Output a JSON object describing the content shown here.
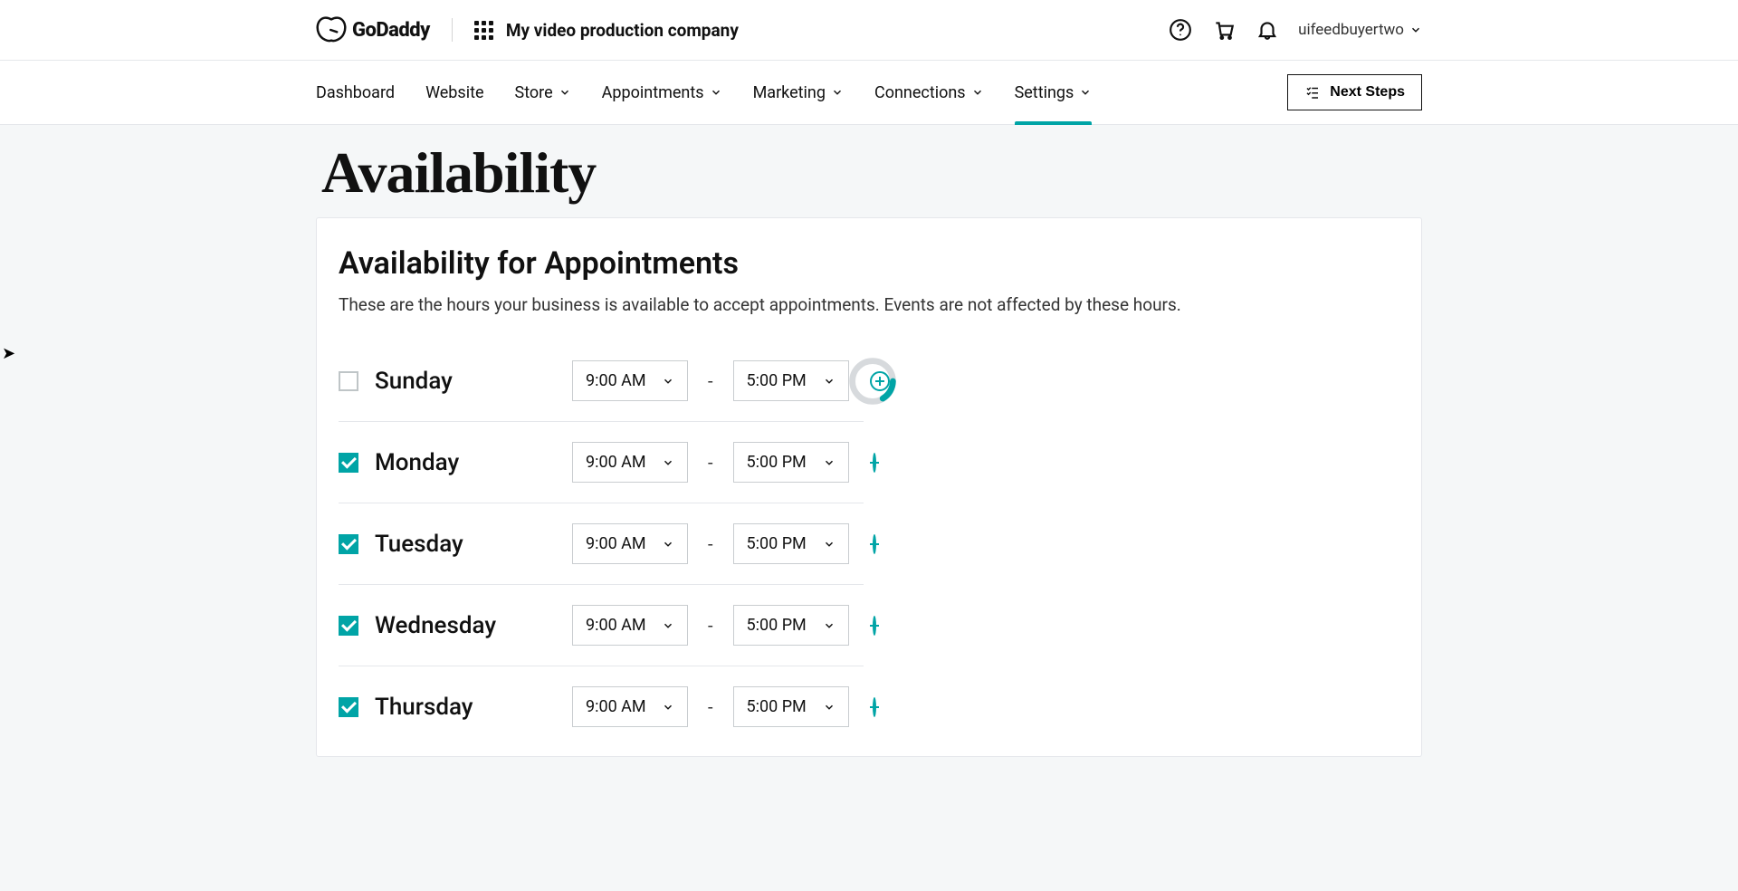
{
  "header": {
    "brand": "GoDaddy",
    "company": "My video production company",
    "user": "uifeedbuyertwo"
  },
  "nav": {
    "items": [
      {
        "label": "Dashboard",
        "dropdown": false,
        "active": false
      },
      {
        "label": "Website",
        "dropdown": false,
        "active": false
      },
      {
        "label": "Store",
        "dropdown": true,
        "active": false
      },
      {
        "label": "Appointments",
        "dropdown": true,
        "active": false
      },
      {
        "label": "Marketing",
        "dropdown": true,
        "active": false
      },
      {
        "label": "Connections",
        "dropdown": true,
        "active": false
      },
      {
        "label": "Settings",
        "dropdown": true,
        "active": true
      }
    ],
    "next_steps": "Next Steps"
  },
  "page": {
    "title": "Availability",
    "section_title": "Availability for Appointments",
    "section_desc": "These are the hours your business is available to accept appointments. Events are not affected by these hours."
  },
  "days": [
    {
      "name": "Sunday",
      "enabled": false,
      "start": "9:00 AM",
      "end": "5:00 PM",
      "loading": true
    },
    {
      "name": "Monday",
      "enabled": true,
      "start": "9:00 AM",
      "end": "5:00 PM",
      "loading": false
    },
    {
      "name": "Tuesday",
      "enabled": true,
      "start": "9:00 AM",
      "end": "5:00 PM",
      "loading": false
    },
    {
      "name": "Wednesday",
      "enabled": true,
      "start": "9:00 AM",
      "end": "5:00 PM",
      "loading": false
    },
    {
      "name": "Thursday",
      "enabled": true,
      "start": "9:00 AM",
      "end": "5:00 PM",
      "loading": false
    }
  ],
  "misc": {
    "dash": "-"
  }
}
